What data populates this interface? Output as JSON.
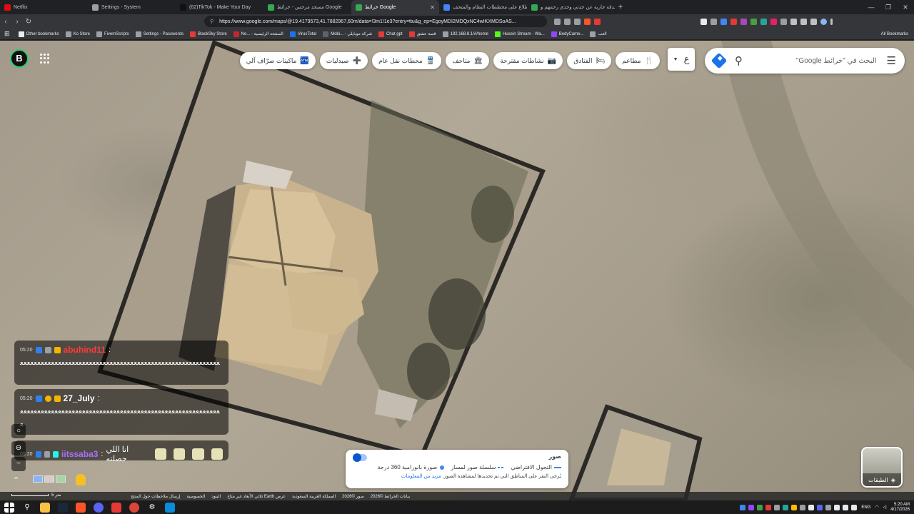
{
  "tabs": [
    {
      "label": "Netflix",
      "color": "#e50914"
    },
    {
      "label": "Settings - System",
      "color": "#9aa0a6"
    },
    {
      "label": "(62)TikTok - Make Your Day",
      "color": "#111111"
    },
    {
      "label": "مسجد مرجس - خرائط Google",
      "color": "#34a853"
    },
    {
      "label": "خرائط Google",
      "color": "#34a853",
      "active": true
    },
    {
      "label": "الاطلاع على مخططات النظام والمتحف",
      "color": "#4285f4"
    },
    {
      "label": "صدقة جارية عن جدتي وجدي رحمهم و...",
      "color": "#34a853"
    }
  ],
  "url": "https://www.google.com/maps/@19.4179573,41.7882967,60m/data=!3m1!1e3?entry=ttu&g_ep=EgoyMDI2MDQxNC4wIKXMDSoAS...",
  "bookmarks": [
    {
      "label": "Other bookmarks",
      "color": "#e8eaed"
    },
    {
      "label": "Ko Store",
      "color": "#9aa0a6"
    },
    {
      "label": "FivemScripts",
      "color": "#9aa0a6"
    },
    {
      "label": "Settings - Passwords",
      "color": "#9aa0a6"
    },
    {
      "label": "BlackSky Store",
      "color": "#e53935"
    },
    {
      "label": "Ne... - الصفحة الرئيسية",
      "color": "#c62828"
    },
    {
      "label": "VirusTotal",
      "color": "#1a73e8"
    },
    {
      "label": "Mobi... - شركة موبايلي",
      "color": "#5f6368"
    },
    {
      "label": "Chat gpt",
      "color": "#e53935"
    },
    {
      "label": "قصة عشق",
      "color": "#e53935"
    },
    {
      "label": "192.168.8.1/#/home",
      "color": "#9aa0a6"
    },
    {
      "label": "Husein Stream - Wa...",
      "color": "#53fc18"
    },
    {
      "label": "BodyCame...",
      "color": "#9146ff"
    },
    {
      "label": "العب",
      "color": "#9aa0a6"
    }
  ],
  "all_bookmarks": "All Bookmarks",
  "maps": {
    "search_placeholder": "البحث في \"خرائط Google\"",
    "language_button": "ع",
    "chips": [
      {
        "label": "مطاعم",
        "icon": "🍴"
      },
      {
        "label": "الفنادق",
        "icon": "🛏"
      },
      {
        "label": "نشاطات مقترحة",
        "icon": "📷"
      },
      {
        "label": "متاحف",
        "icon": "🏛"
      },
      {
        "label": "محطات نقل عام",
        "icon": "🚆"
      },
      {
        "label": "صيدليات",
        "icon": "➕"
      },
      {
        "label": "ماكينات صرّاف آلي",
        "icon": "🏧"
      }
    ],
    "layers_label": "الطبقات",
    "legend": {
      "title": "صور",
      "item_360": "صورة بانورامية 360 درجة",
      "item_sequence": "سلسلة صور لمسار",
      "item_tour": "التجول الافتراضي",
      "note": "يُرجى النقر على المناطق التي تم تحديدها لمشاهدة الصور.",
      "more_link": "مزيد من المعلومات"
    },
    "footer": [
      "بيانات الخرائط ©2026",
      "صور ©2026",
      "المملكة العربية السعودية",
      "عرض Earth ثلاثي الأبعاد غير متاح",
      "البنود",
      "الخصوصية",
      "إرسال ملاحظات حول المنتج"
    ],
    "scale": "5 متر"
  },
  "chat": [
    {
      "time": "05:20",
      "user": "abuhind11",
      "user_color": "#ff3b3b",
      "message": "ﻌﻌﻌﻌﻌﻌﻌﻌﻌﻌﻌﻌﻌﻌﻌﻌﻌﻌﻌﻌﻌﻌﻌﻌﻌﻌﻌﻌﻌﻌﻌﻌﻌﻌﻌﻌﻌﻌﻌﻌﻌﻌﻌﻌﻌﻌﻌﻌﻌﻌﻌﻌﻌﻌﻌﻌﻌﻌ"
    },
    {
      "time": "05:20",
      "user": "27_July",
      "user_color": "#ffffff",
      "message": "ﻌﻌﻌﻌﻌﻌﻌﻌﻌﻌﻌﻌﻌﻌﻌﻌﻌﻌﻌﻌﻌﻌﻌﻌﻌﻌﻌﻌﻌﻌﻌﻌﻌﻌﻌﻌﻌﻌﻌﻌﻌﻌﻌﻌﻌﻌﻌﻌﻌﻌﻌﻌﻌﻌﻌﻌﻌﻌﻌ"
    },
    {
      "time": "05:20",
      "user": "iitssaba3",
      "user_color": "#a970ff",
      "message": "انا اللي حصلته"
    }
  ],
  "taskbar": {
    "time": "5:20 AM",
    "date": "4/17/2026",
    "lang": "ENG"
  }
}
